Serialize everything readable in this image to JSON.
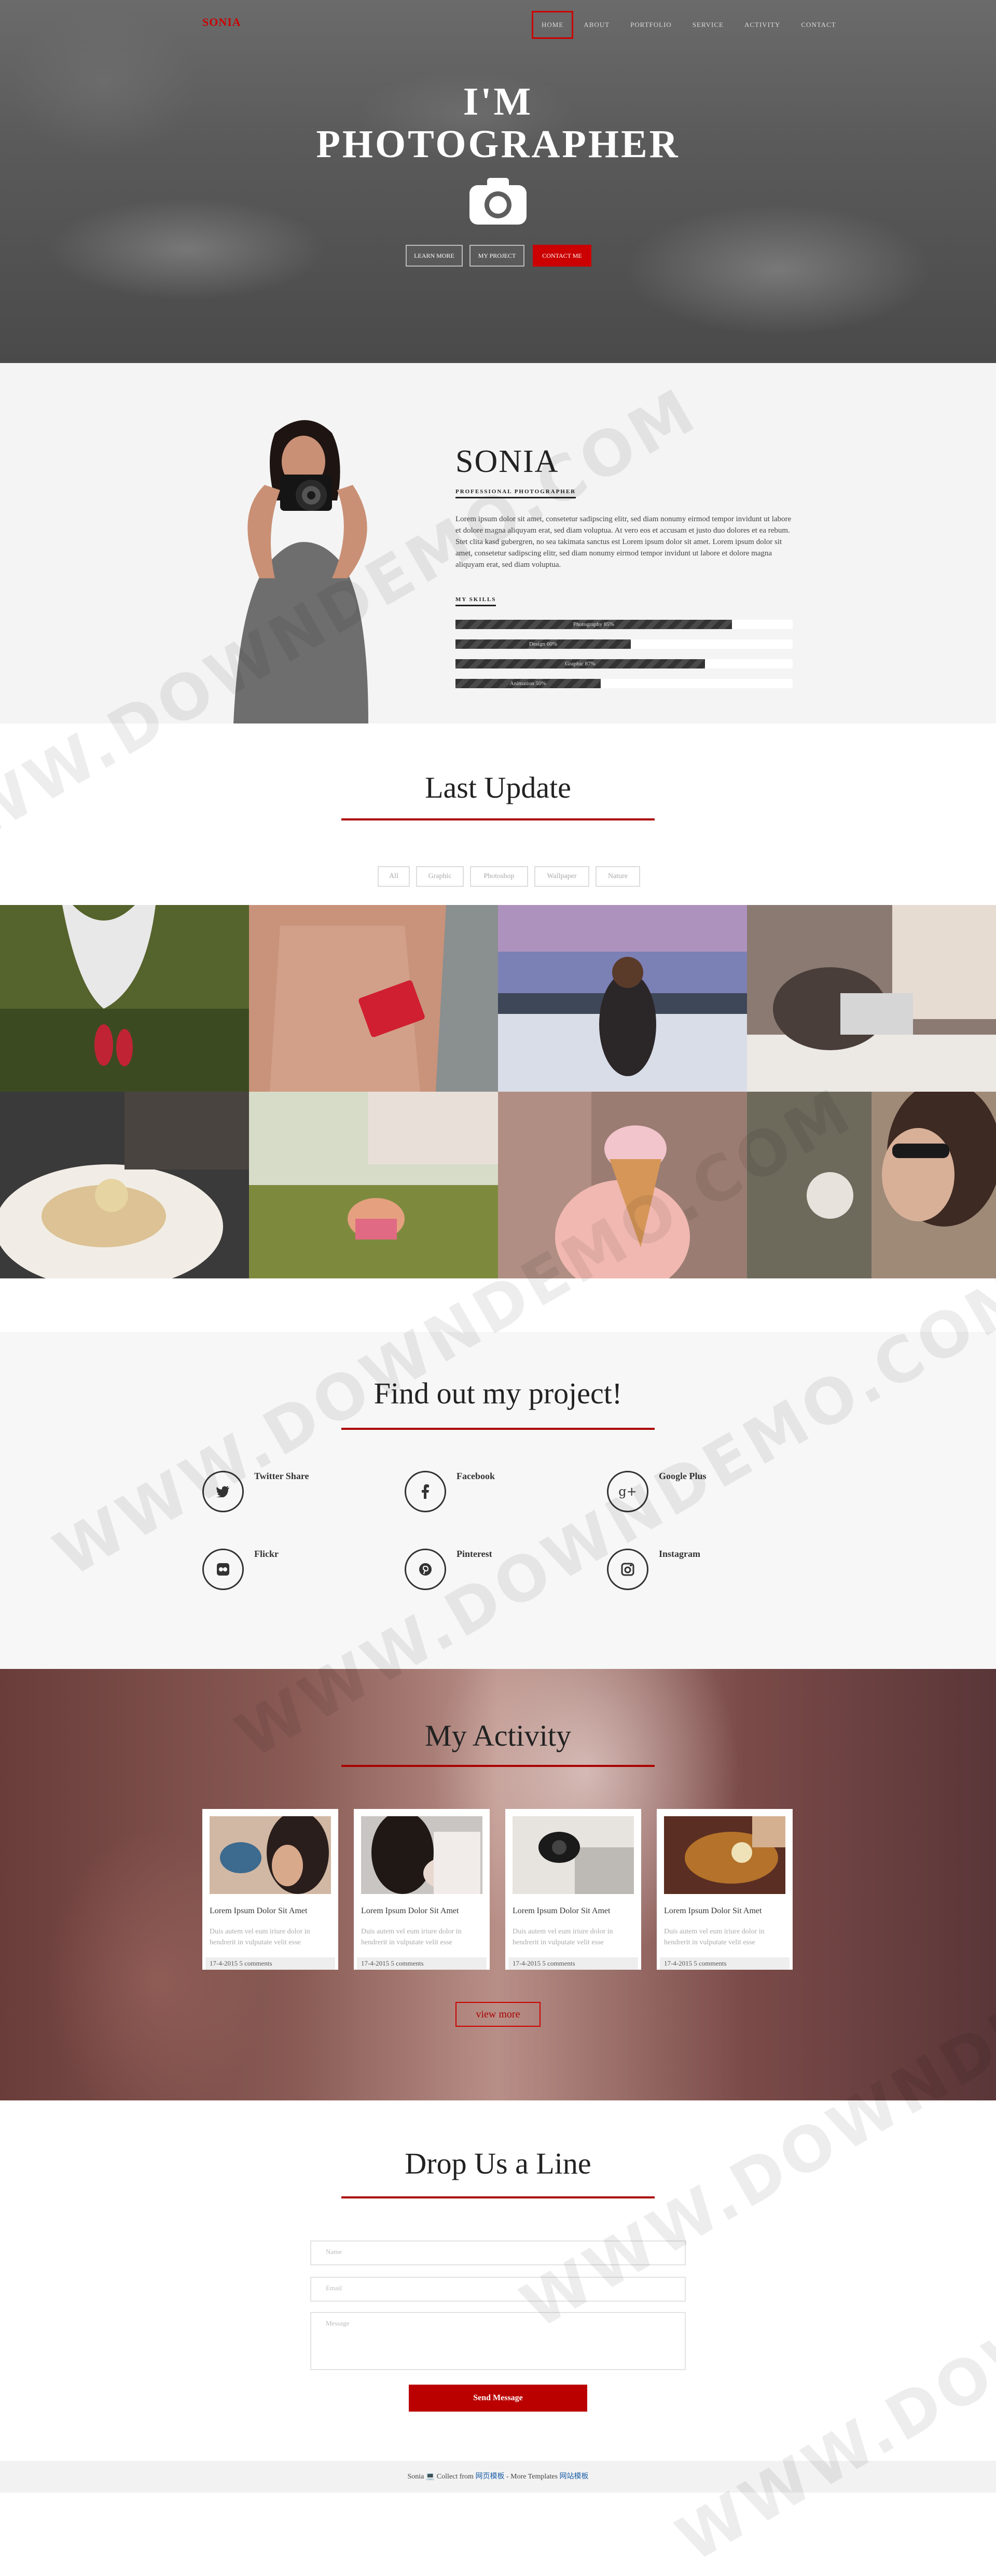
{
  "brand": "SONIA",
  "nav": [
    "HOME",
    "ABOUT",
    "PORTFOLIO",
    "SERVICE",
    "ACTIVITY",
    "CONTACT"
  ],
  "hero": {
    "title_line1": "I'M",
    "title_line2": "PHOTOGRAPHER",
    "buttons": [
      "LEARN MORE",
      "MY PROJECT",
      "CONTACT ME"
    ]
  },
  "about": {
    "name": "SONIA",
    "subtitle": "PROFESSIONAL PHOTOGRAPHER",
    "text": "Lorem ipsum dolor sit amet, consetetur sadipscing elitr, sed diam nonumy eirmod tempor invidunt ut labore et dolore magna aliquyam erat, sed diam voluptua. At vero eos et accusam et justo duo dolores et ea rebum. Stet clita kasd gubergren, no sea takimata sanctus est Lorem ipsum dolor sit amet. Lorem ipsum dolor sit amet, consetetur sadipscing elitr, sed diam nonumy eirmod tempor invidunt ut labore et dolore magna aliquyam erat, sed diam voluptua.",
    "skills_title": "MY SKILLS",
    "skills": [
      {
        "label": "Photography 85%",
        "value": 0.82
      },
      {
        "label": "Design 60%",
        "value": 0.52
      },
      {
        "label": "Graphic 87%",
        "value": 0.74
      },
      {
        "label": "Animation 50%",
        "value": 0.43
      }
    ]
  },
  "last_update": {
    "title": "Last Update",
    "filters": [
      "All",
      "Graphic",
      "Photoshop",
      "Wallpaper",
      "Nature"
    ]
  },
  "project": {
    "title": "Find out my project!",
    "socials": [
      "Twitter Share",
      "Facebook",
      "Google Plus",
      "Flickr",
      "Pinterest",
      "Instagram"
    ]
  },
  "activity": {
    "title": "My Activity",
    "cards": [
      {
        "title": "Lorem Ipsum Dolor Sit Amet",
        "text": "Duis autem vel eum iriure dolor in hendrerit in vulputate velit esse",
        "meta": "17-4-2015   5 comments"
      },
      {
        "title": "Lorem Ipsum Dolor Sit Amet",
        "text": "Duis autem vel eum iriure dolor in hendrerit in vulputate velit esse",
        "meta": "17-4-2015   5 comments"
      },
      {
        "title": "Lorem Ipsum Dolor Sit Amet",
        "text": "Duis autem vel eum iriure dolor in hendrerit in vulputate velit esse",
        "meta": "17-4-2015   5 comments"
      },
      {
        "title": "Lorem Ipsum Dolor Sit Amet",
        "text": "Duis autem vel eum iriure dolor in hendrerit in vulputate velit esse",
        "meta": "17-4-2015   5 comments"
      }
    ],
    "view_more": "view more"
  },
  "contact": {
    "title": "Drop Us a Line",
    "name_placeholder": "Name",
    "email_placeholder": "Email",
    "message_placeholder": "Message",
    "send": "Send Message"
  },
  "footer": {
    "prefix": "Sonia",
    "collect": "Collect from",
    "link1": "网页模板",
    "middle": "- More Templates",
    "link2": "网站模板"
  },
  "watermark": "WWW.DOWNDEMO.COM"
}
